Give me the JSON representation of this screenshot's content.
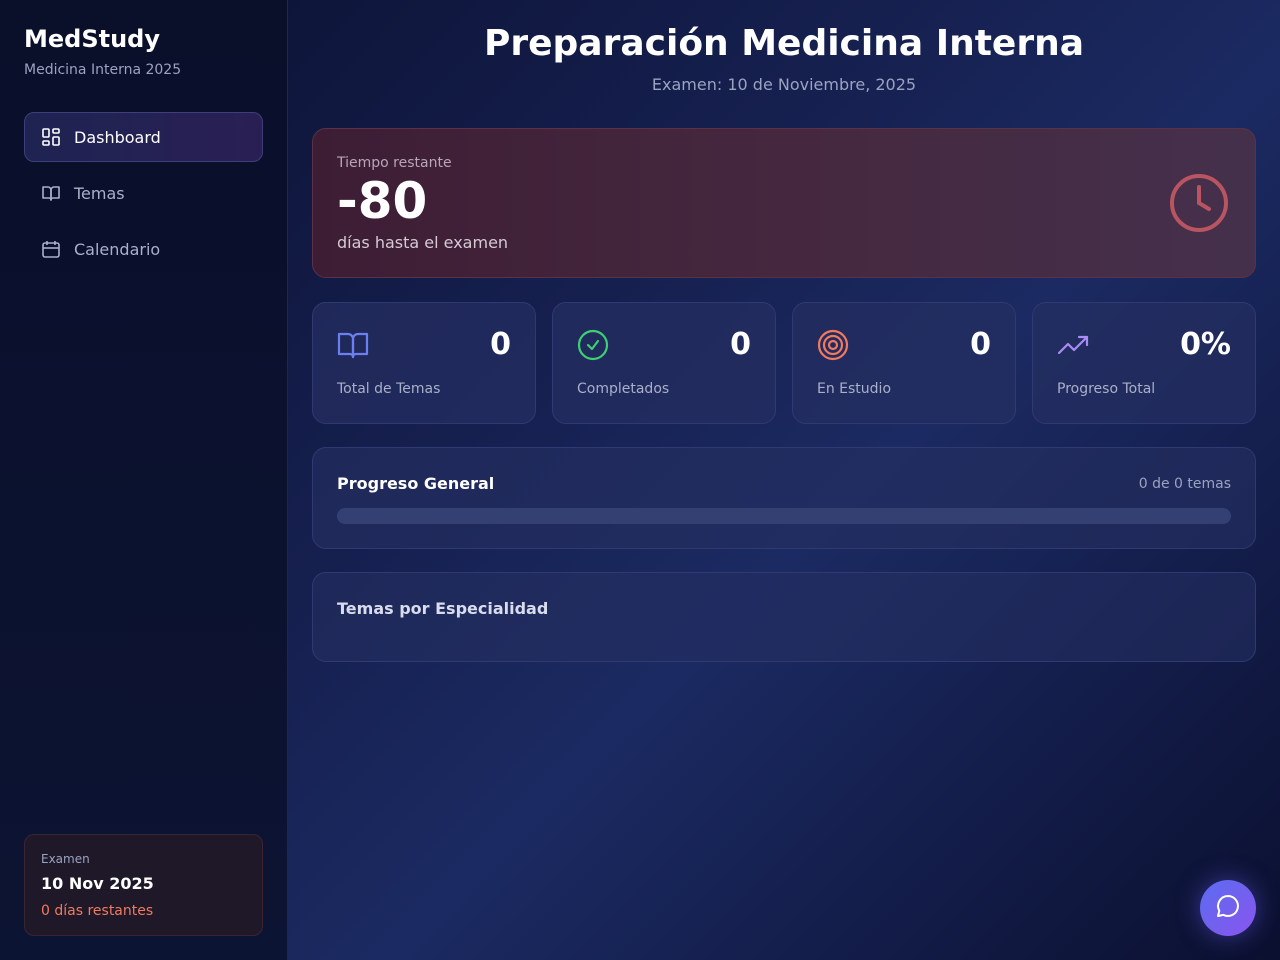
{
  "sidebar": {
    "brand": "MedStudy",
    "brand_sub": "Medicina Interna 2025",
    "items": [
      {
        "label": "Dashboard",
        "icon": "dashboard-icon",
        "active": true
      },
      {
        "label": "Temas",
        "icon": "book-icon",
        "active": false
      },
      {
        "label": "Calendario",
        "icon": "calendar-icon",
        "active": false
      }
    ],
    "exam_card": {
      "label": "Examen",
      "date": "10 Nov 2025",
      "remaining": "0 días restantes"
    }
  },
  "header": {
    "title": "Preparación Medicina Interna",
    "subtitle": "Examen: 10 de Noviembre, 2025"
  },
  "countdown": {
    "label": "Tiempo restante",
    "value": "-80",
    "text": "días hasta el examen",
    "icon": "clock-icon"
  },
  "stats": [
    {
      "value": "0",
      "label": "Total de Temas",
      "icon": "book-open-icon",
      "color": "#6b7ff0"
    },
    {
      "value": "0",
      "label": "Completados",
      "icon": "check-circle-icon",
      "color": "#3ecf74"
    },
    {
      "value": "0",
      "label": "En Estudio",
      "icon": "target-icon",
      "color": "#f07a5e"
    },
    {
      "value": "0%",
      "label": "Progreso Total",
      "icon": "trending-up-icon",
      "color": "#a98cf5"
    }
  ],
  "progress": {
    "title": "Progreso General",
    "count": "0 de 0 temas",
    "percent": 0
  },
  "specialties": {
    "title": "Temas por Especialidad"
  },
  "chat": {
    "icon": "chat-icon"
  }
}
